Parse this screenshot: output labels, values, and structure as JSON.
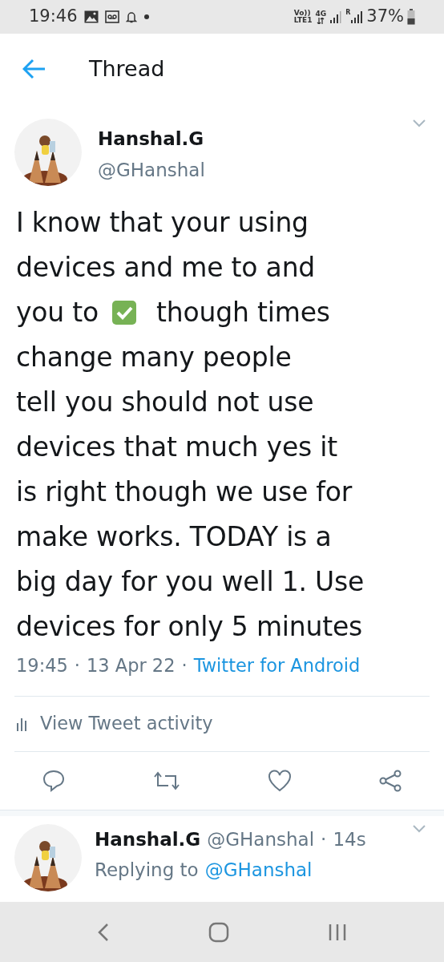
{
  "status_bar": {
    "time": "19:46",
    "network_top": "Vo))",
    "network_bottom": "LTE1",
    "data_label": "4G",
    "roaming_label": "R",
    "battery": "37%"
  },
  "header": {
    "title": "Thread"
  },
  "tweet": {
    "name": "Hanshal.G",
    "handle": "@GHanshal",
    "body_lines": [
      {
        "kind": "text",
        "text": "I know that your using"
      },
      {
        "kind": "text",
        "text": "devices and me to and"
      },
      {
        "kind": "check_emoji",
        "before": "you to",
        "after": "though times"
      },
      {
        "kind": "text",
        "text": "change many people"
      },
      {
        "kind": "text",
        "text": "tell you should not use"
      },
      {
        "kind": "text",
        "text": "devices that much yes it"
      },
      {
        "kind": "text",
        "text": "is right though we use for"
      },
      {
        "kind": "text",
        "text": "make works. TODAY is a"
      },
      {
        "kind": "text",
        "text": "big day for you well 1. Use"
      },
      {
        "kind": "text",
        "text": "devices for only 5 minutes"
      }
    ],
    "time": "19:45",
    "separator": "·",
    "date": "13 Apr 22",
    "separator_2": "·",
    "source": "Twitter for Android",
    "activity": "View Tweet activity"
  },
  "reply": {
    "name": "Hanshal.G",
    "handle": "@GHanshal",
    "separator": "·",
    "age": "14s",
    "replying_label": "Replying to",
    "replying_to": "@GHanshal"
  }
}
